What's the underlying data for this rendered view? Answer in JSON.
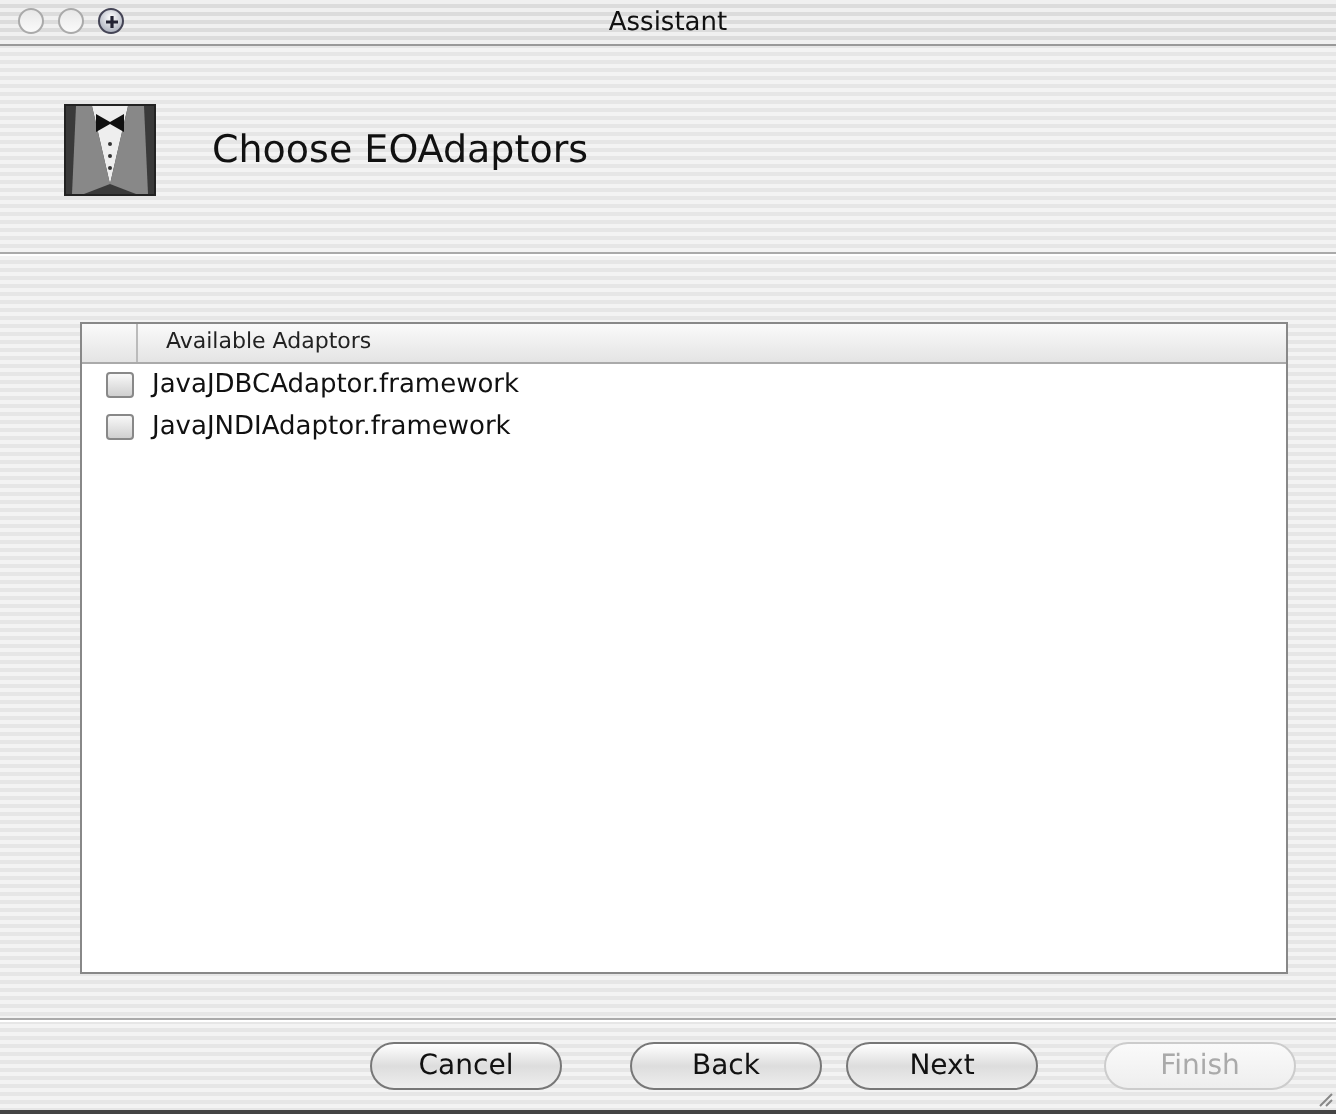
{
  "window": {
    "title": "Assistant",
    "controls": [
      {
        "kind": "close",
        "disabled": true
      },
      {
        "kind": "minimize",
        "disabled": true
      },
      {
        "kind": "zoom",
        "disabled": false
      }
    ]
  },
  "header": {
    "title": "Choose EOAdaptors"
  },
  "table": {
    "columns": [
      "Available Adaptors"
    ],
    "rows": [
      {
        "name": "JavaJDBCAdaptor.framework",
        "checked": false
      },
      {
        "name": "JavaJNDIAdaptor.framework",
        "checked": false
      }
    ]
  },
  "buttons": [
    {
      "label": "Cancel",
      "disabled": false
    },
    {
      "label": "Back",
      "disabled": false
    },
    {
      "label": "Next",
      "disabled": false
    },
    {
      "label": "Finish",
      "disabled": true
    }
  ]
}
